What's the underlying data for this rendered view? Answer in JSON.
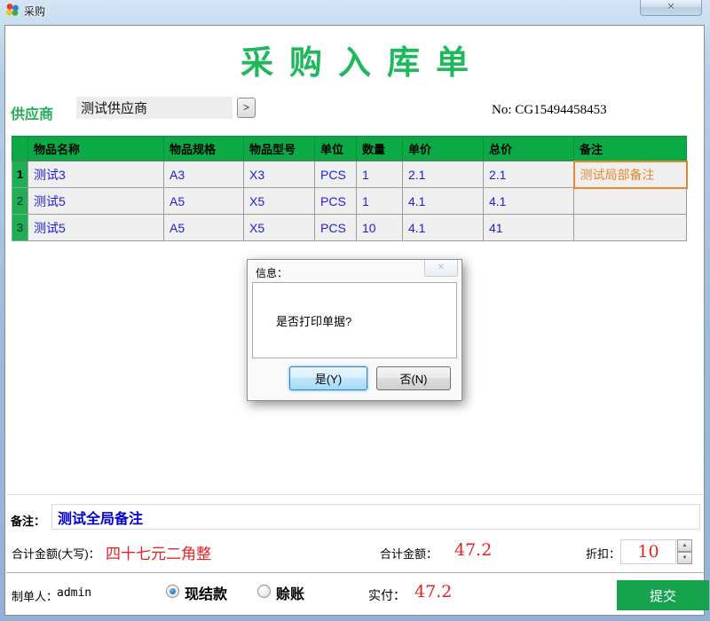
{
  "window": {
    "title": "采购",
    "close_icon": "✕"
  },
  "form": {
    "title": "采购入库单",
    "supplier_label": "供应商",
    "supplier_value": "测试供应商",
    "browse_icon": ">",
    "no_text": "No: CG15494458453"
  },
  "table": {
    "headers": [
      "物品名称",
      "物品规格",
      "物品型号",
      "单位",
      "数量",
      "单价",
      "总价",
      "备注"
    ],
    "rows": [
      {
        "num": "1",
        "name": "测试3",
        "spec": "A3",
        "model": "X3",
        "unit": "PCS",
        "qty": "1",
        "price": "2.1",
        "total": "2.1",
        "remark": "测试局部备注"
      },
      {
        "num": "2",
        "name": "测试5",
        "spec": "A5",
        "model": "X5",
        "unit": "PCS",
        "qty": "1",
        "price": "4.1",
        "total": "4.1",
        "remark": ""
      },
      {
        "num": "3",
        "name": "测试5",
        "spec": "A5",
        "model": "X5",
        "unit": "PCS",
        "qty": "10",
        "price": "4.1",
        "total": "41",
        "remark": ""
      }
    ]
  },
  "dialog": {
    "title": "信息：",
    "close_icon": "✕",
    "message": "是否打印单据?",
    "yes_label": "是(Y)",
    "no_label": "否(N)"
  },
  "footer": {
    "remark_label": "备注：",
    "remark_value": "测试全局备注",
    "total_words_label": "合计金额(大写)：",
    "total_words_value": "四十七元二角整",
    "total_label": "合计金额：",
    "total_value": "47.2",
    "discount_label": "折扣：",
    "discount_value": "10",
    "creator_label": "制单人：",
    "creator_value": "admin",
    "pay_cash_label": "现结款",
    "pay_cash_selected": true,
    "pay_credit_label": "赊账",
    "pay_credit_selected": false,
    "paid_label": "实付：",
    "paid_value": "47.2",
    "submit_label": "提交"
  },
  "icons": {
    "spin_up": "▲",
    "spin_down": "▼"
  },
  "colors": {
    "header_green": "#0ca947",
    "title_green": "#1fb85b",
    "data_blue": "#2121d6",
    "alert_red": "#e32222",
    "selected_orange": "#e8862c",
    "submit_green": "#17a34e"
  }
}
